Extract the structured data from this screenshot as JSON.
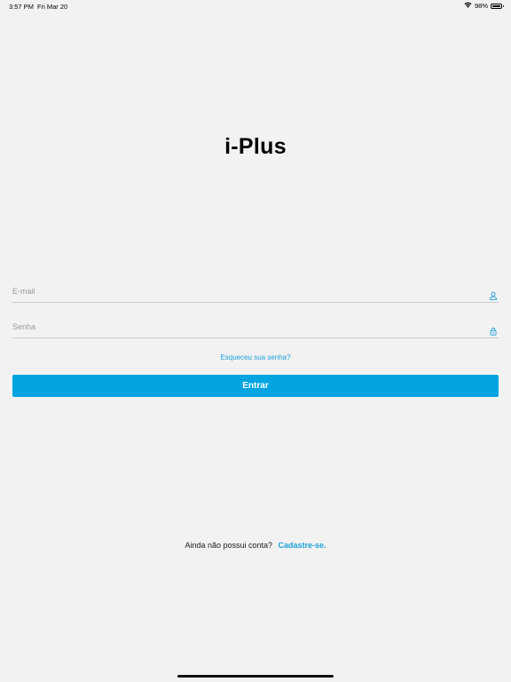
{
  "status_bar": {
    "time": "3:57 PM",
    "date": "Fri Mar 20",
    "battery_percent": "98%",
    "battery_level": 0.98
  },
  "app": {
    "title": "i-Plus"
  },
  "login_form": {
    "email_placeholder": "E-mail",
    "email_value": "",
    "email_icon": "user-icon",
    "password_placeholder": "Senha",
    "password_value": "",
    "password_icon": "lock-icon",
    "forgot_password": "Esqueceu sua senha?",
    "submit_label": "Entrar"
  },
  "signup": {
    "prompt": "Ainda não possui conta?",
    "link": "Cadastre-se."
  },
  "colors": {
    "accent": "#03a4e2",
    "background": "#f2f2f2"
  }
}
